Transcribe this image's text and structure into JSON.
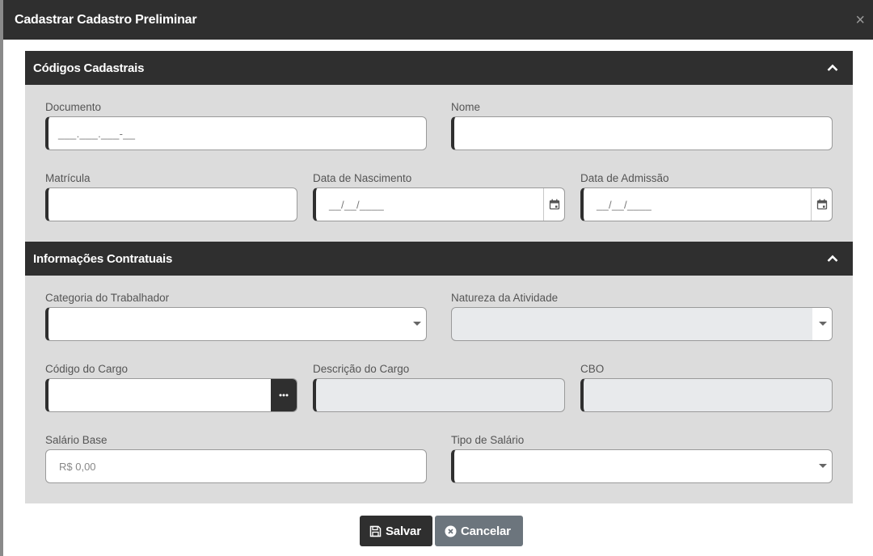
{
  "modal": {
    "title": "Cadastrar Cadastro Preliminar",
    "close_label": "×"
  },
  "sections": {
    "codigos": {
      "title": "Códigos Cadastrais"
    },
    "contratuais": {
      "title": "Informações Contratuais"
    }
  },
  "fields": {
    "documento": {
      "label": "Documento",
      "mask": "___.___.___-__",
      "value": ""
    },
    "nome": {
      "label": "Nome",
      "value": ""
    },
    "matricula": {
      "label": "Matrícula",
      "value": ""
    },
    "data_nascimento": {
      "label": "Data de Nascimento",
      "mask": "__/__/____"
    },
    "data_admissao": {
      "label": "Data de Admissão",
      "mask": "__/__/____"
    },
    "categoria_trabalhador": {
      "label": "Categoria do Trabalhador",
      "selected": ""
    },
    "natureza_atividade": {
      "label": "Natureza da Atividade",
      "selected": ""
    },
    "codigo_cargo": {
      "label": "Código do Cargo",
      "value": ""
    },
    "descricao_cargo": {
      "label": "Descrição do Cargo",
      "value": ""
    },
    "cbo": {
      "label": "CBO",
      "value": ""
    },
    "salario_base": {
      "label": "Salário Base",
      "placeholder": "R$ 0,00"
    },
    "tipo_salario": {
      "label": "Tipo de Salário",
      "selected": ""
    }
  },
  "buttons": {
    "save_label": "Salvar",
    "cancel_label": "Cancelar"
  },
  "icons": {
    "close": "close-icon",
    "collapse": "chevron-up-icon",
    "calendar": "calendar-icon",
    "dropdown": "caret-down-icon",
    "lookup": "ellipsis-icon",
    "save": "floppy-disk-icon",
    "cancel": "x-circle-icon"
  },
  "colors": {
    "header_bg": "#2f2f2f",
    "section_bg": "#dcdcdc",
    "cancel_bg": "#6c757d",
    "disabled_bg": "#e8eaec"
  }
}
